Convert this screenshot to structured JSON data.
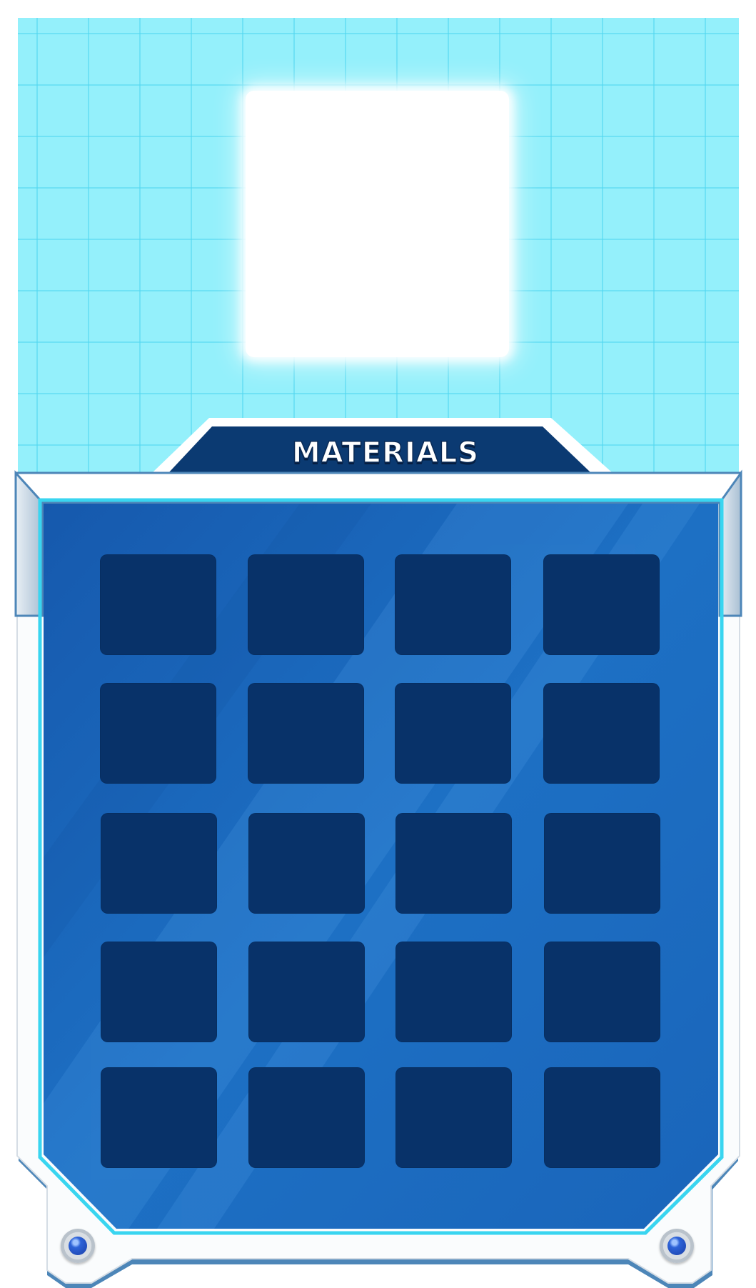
{
  "panel": {
    "title": "MATERIALS"
  },
  "colors": {
    "background_grid": "#94f0fb",
    "panel_blue": "#1b67bc",
    "slot_navy": "#083269",
    "frame_white": "#fafcfd",
    "frame_edge": "#4d86b8"
  },
  "inventory": {
    "rows": 5,
    "columns": 4,
    "filled_slots": 0
  },
  "icons": {
    "rivets": [
      "bolt-gem-icon",
      "bolt-gem-icon"
    ]
  }
}
